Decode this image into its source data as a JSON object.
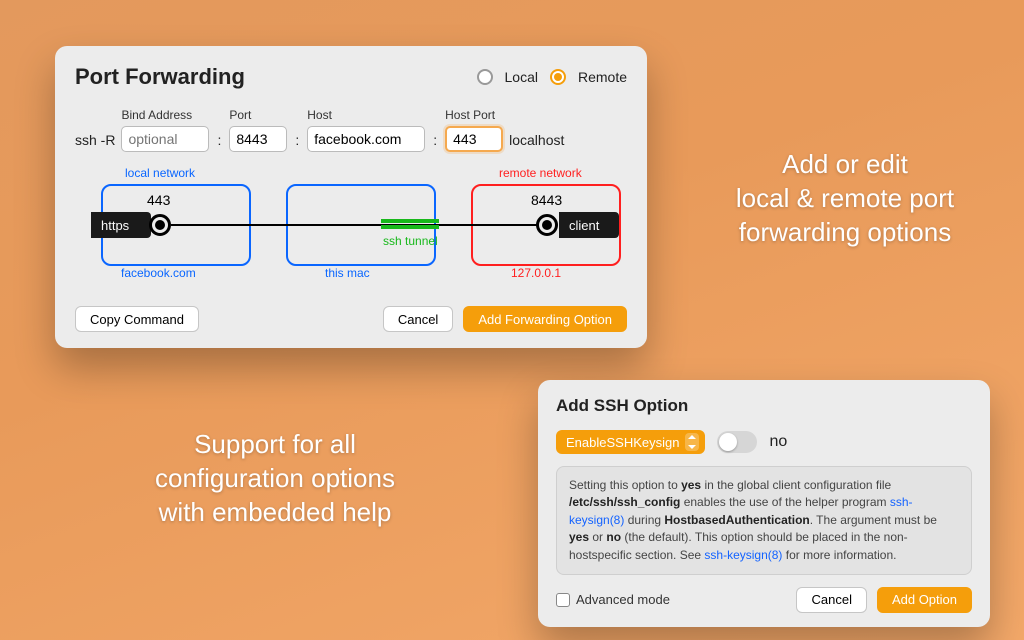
{
  "caption1": "Add or edit\nlocal & remote port\nforwarding options",
  "caption2": "Support for all\nconfiguration options\nwith embedded help",
  "port_forwarding": {
    "title": "Port Forwarding",
    "radio": {
      "local": "Local",
      "remote": "Remote",
      "selected": "remote"
    },
    "cmd": {
      "lead": "ssh -R",
      "bind_label": "Bind Address",
      "bind_placeholder": "optional",
      "bind_value": "",
      "port_label": "Port",
      "port_value": "8443",
      "host_label": "Host",
      "host_value": "facebook.com",
      "hostport_label": "Host Port",
      "hostport_value": "443",
      "tail": "localhost"
    },
    "diagram": {
      "local_network": "local network",
      "remote_network": "remote network",
      "left_chip": "https",
      "right_chip": "client",
      "left_port": "443",
      "right_port": "8443",
      "left_bottom": "facebook.com",
      "mid_bottom": "this mac",
      "right_bottom": "127.0.0.1",
      "tunnel": "ssh tunnel"
    },
    "buttons": {
      "copy": "Copy Command",
      "cancel": "Cancel",
      "add": "Add Forwarding Option"
    }
  },
  "ssh_option": {
    "title": "Add SSH Option",
    "select_value": "EnableSSHKeysign",
    "toggle_value": "no",
    "help_pre": "Setting this option to ",
    "help_yes": "yes",
    "help_mid1": " in the global client configuration file ",
    "help_path": "/etc/ssh/ssh_config",
    "help_mid2": " enables the use of the helper program ",
    "help_link1": "ssh-keysign(8)",
    "help_mid3": " during ",
    "help_hba": "HostbasedAuthentication",
    "help_mid4": ". The argument must be ",
    "help_yes2": "yes",
    "help_or": " or ",
    "help_no": "no",
    "help_tail": " (the default). This option should be placed in the non-hostspecific section. See ",
    "help_link2": "ssh-keysign(8)",
    "help_end": " for more information.",
    "advanced": "Advanced mode",
    "cancel": "Cancel",
    "add": "Add Option"
  }
}
